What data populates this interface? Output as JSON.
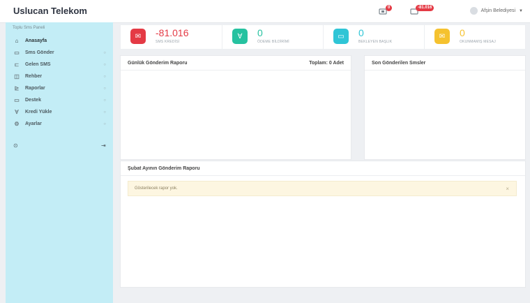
{
  "header": {
    "brand": "Uslucan Telekom",
    "notif_badge": "0",
    "credit_badge": "-81.016",
    "user_name": "Afşin Belediyesi"
  },
  "sidebar": {
    "title": "Toplu Sms Paneli",
    "items": [
      {
        "label": "Anasayfa",
        "icon": "home-icon"
      },
      {
        "label": "Sms Gönder",
        "icon": "envelope-icon"
      },
      {
        "label": "Gelen SMS",
        "icon": "inbox-icon"
      },
      {
        "label": "Rehber",
        "icon": "book-icon"
      },
      {
        "label": "Raporlar",
        "icon": "chart-icon"
      },
      {
        "label": "Destek",
        "icon": "chat-icon"
      },
      {
        "label": "Kredi Yükle",
        "icon": "cart-icon"
      },
      {
        "label": "Ayarlar",
        "icon": "gear-icon"
      }
    ]
  },
  "stats": [
    {
      "value": "-81.016",
      "label": "SMS KREDİSİ",
      "color": "#e43a45",
      "icon": "envelope-icon"
    },
    {
      "value": "0",
      "label": "ÖDEME BİLDİRİMİ",
      "color": "#26c2a0",
      "icon": "cart-icon"
    },
    {
      "value": "0",
      "label": "BEKLEYEN BAŞLIK",
      "color": "#2fc5d6",
      "icon": "window-icon"
    },
    {
      "value": "0",
      "label": "OKUNMAMIŞ MESAJ",
      "color": "#f5c22f",
      "icon": "mail-icon"
    }
  ],
  "panels": {
    "daily_title": "Günlük Gönderim Raporu",
    "daily_total": "Toplam: 0 Adet",
    "recent_title": "Son Gönderilen Smsler",
    "monthly_title": "Şubat Ayının Gönderim Raporu",
    "monthly_alert": "Gösterilecek rapor yok."
  }
}
